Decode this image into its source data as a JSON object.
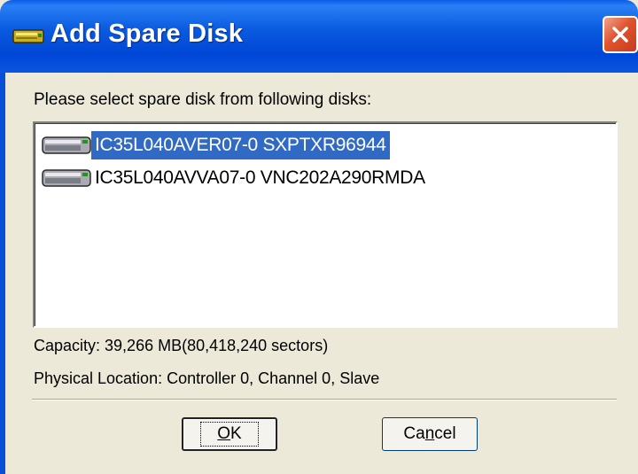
{
  "window": {
    "title": "Add Spare Disk",
    "close_icon": "close-icon"
  },
  "dialog": {
    "prompt": "Please select spare disk from following disks:",
    "disks": [
      {
        "label": "IC35L040AVER07-0 SXPTXR96944",
        "selected": true,
        "icon": "hard-disk-icon"
      },
      {
        "label": "IC35L040AVVA07-0 VNC202A290RMDA",
        "selected": false,
        "icon": "hard-disk-icon"
      }
    ],
    "capacity": "Capacity: 39,266 MB(80,418,240 sectors)",
    "physical_location": "Physical Location: Controller 0, Channel 0, Slave"
  },
  "buttons": {
    "ok": {
      "prefix": "",
      "mnemonic": "O",
      "suffix": "K"
    },
    "cancel": {
      "prefix": "Ca",
      "mnemonic": "n",
      "suffix": "cel"
    }
  },
  "colors": {
    "titlebar": "#0054e3",
    "selection": "#316ac5",
    "dialog_bg": "#ece9d8",
    "close_button": "#e0532f"
  }
}
